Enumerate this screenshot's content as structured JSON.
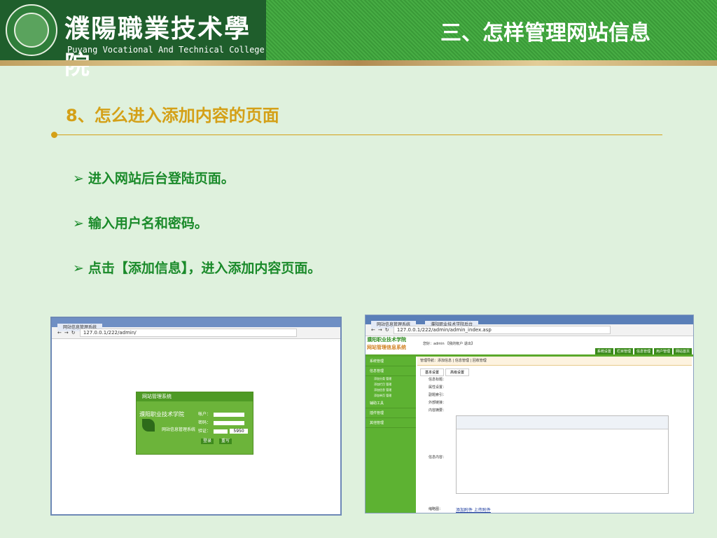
{
  "header": {
    "college_cn": "濮陽職業技术學院",
    "college_en": "Puyang Vocational And Technical College",
    "section_title": "三、怎样管理网站信息"
  },
  "content": {
    "heading": "8、怎么进入添加内容的页面",
    "bullets": [
      "进入网站后台登陆页面。",
      "输入用户名和密码。",
      "点击【添加信息】，进入添加内容页面。"
    ]
  },
  "screenshot_login": {
    "tab": "网站信息管理系统",
    "url": "127.0.0.1/222/admin/",
    "box_title": "网站管理系统",
    "school": "濮阳职业技术学院",
    "system_name": "网站信息管理系统",
    "user_label": "帐户：",
    "password_label": "密码：",
    "code_label": "验证：",
    "captcha": "5950",
    "login_btn": "登录",
    "reset_btn": "重写"
  },
  "screenshot_admin": {
    "tab": "网站信息管理系统",
    "tab2": "濮阳职业技术学院后台",
    "url": "127.0.0.1/222/admin/admin_index.asp",
    "logo1": "濮阳职业技术学院",
    "logo2": "网站管理信息系统",
    "user": "您好：admin 【我的帐户 退出】",
    "nav": [
      "系统设置",
      "栏目管理",
      "信息管理",
      "用户管理",
      "网站首页"
    ],
    "side": [
      "系统管理",
      "信息管理",
      "辅助工具",
      "插件管理",
      "其他管理"
    ],
    "side_sub": [
      "添加分类  管理",
      "添加栏目  管理",
      "添加信息  管理",
      "添加单页  管理"
    ],
    "breadcrumb": "管理导航：添加信息 | 信息管理 | 回收管理",
    "tabs": [
      "基本设置",
      "高级设置"
    ],
    "fields": [
      "信息标题：",
      "属性设置：",
      "副题索引：",
      "外部链接：",
      "内容摘要："
    ],
    "content_label": "信息内容：",
    "footer_label": "缩略图：",
    "links": "添加附件    上传附件"
  }
}
